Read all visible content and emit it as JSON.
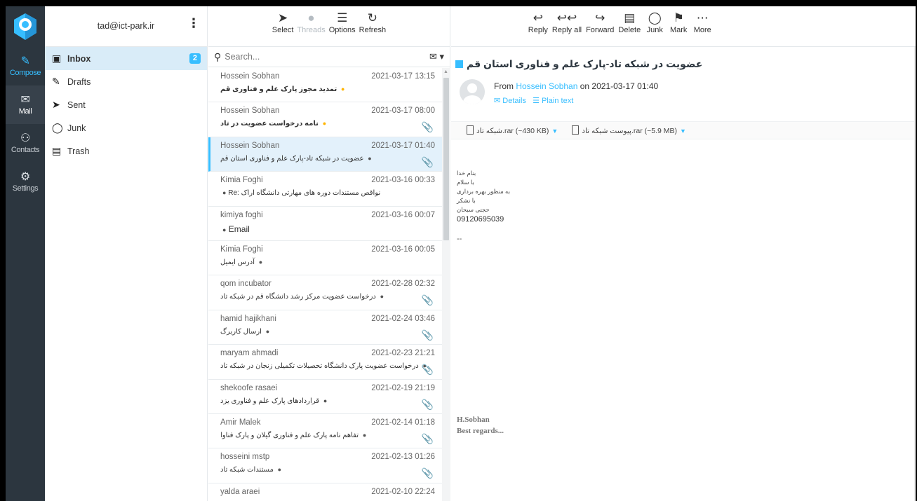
{
  "nav": {
    "items": [
      {
        "label": "Compose",
        "icon": "compose-icon"
      },
      {
        "label": "Mail",
        "icon": "envelope-icon"
      },
      {
        "label": "Contacts",
        "icon": "contacts-icon"
      },
      {
        "label": "Settings",
        "icon": "gear-icon"
      }
    ],
    "active": "Mail"
  },
  "account": {
    "email": "tad@ict-park.ir"
  },
  "folders": [
    {
      "label": "Inbox",
      "icon": "inbox-icon",
      "count": "2",
      "selected": true
    },
    {
      "label": "Drafts",
      "icon": "pencil-icon"
    },
    {
      "label": "Sent",
      "icon": "paper-plane-icon"
    },
    {
      "label": "Junk",
      "icon": "fire-icon"
    },
    {
      "label": "Trash",
      "icon": "trash-icon"
    }
  ],
  "list_toolbar": {
    "select": "Select",
    "threads": "Threads",
    "options": "Options",
    "refresh": "Refresh"
  },
  "search": {
    "placeholder": "Search..."
  },
  "messages": [
    {
      "from": "Hossein Sobhan",
      "date": "2021-03-17 13:15",
      "subject": "تمدید مجوز پارک علم و فناوری قم",
      "unread": true,
      "flag": true,
      "attachment": false
    },
    {
      "from": "Hossein Sobhan",
      "date": "2021-03-17 08:00",
      "subject": "نامه درخواست عضویت در تاد",
      "unread": true,
      "flag": true,
      "attachment": true
    },
    {
      "from": "Hossein Sobhan",
      "date": "2021-03-17 01:40",
      "subject": "عضویت در شبکه تاد-پارک علم و فناوری استان قم",
      "selected": true,
      "attachment": true
    },
    {
      "from": "Kimia Foghi",
      "date": "2021-03-16 00:33",
      "subject": "Re: نواقص مستندات دوره های مهارتی دانشگاه اراک",
      "attachment": false
    },
    {
      "from": "kimiya foghi",
      "date": "2021-03-16 00:07",
      "subject": "Email",
      "attachment": false
    },
    {
      "from": "Kimia Foghi",
      "date": "2021-03-16 00:05",
      "subject": "آدرس ایمیل",
      "attachment": false
    },
    {
      "from": "qom incubator",
      "date": "2021-02-28 02:32",
      "subject": "درخواست عضویت مرکز رشد دانشگاه قم در شبکه تاد",
      "attachment": true
    },
    {
      "from": "hamid hajikhani",
      "date": "2021-02-24 03:46",
      "subject": "ارسال کاربرگ",
      "attachment": true
    },
    {
      "from": "maryam ahmadi",
      "date": "2021-02-23 21:21",
      "subject": "درخواست عضویت پارک دانشگاه تحصیلات تکمیلی زنجان در شبکه تاد",
      "attachment": true
    },
    {
      "from": "shekoofe rasaei",
      "date": "2021-02-19 21:19",
      "subject": "قراردادهای پارک علم و فناوری یزد",
      "attachment": true
    },
    {
      "from": "Amir Malek",
      "date": "2021-02-14 01:18",
      "subject": "تفاهم نامه پارک علم و فناوری گیلان و پارک فناوا",
      "attachment": true
    },
    {
      "from": "hosseini mstp",
      "date": "2021-02-13 01:26",
      "subject": "مستندات شبکه تاد",
      "attachment": true
    },
    {
      "from": "yalda araei",
      "date": "2021-02-10 22:24",
      "subject": "",
      "attachment": true
    }
  ],
  "preview_toolbar": {
    "reply": "Reply",
    "reply_all": "Reply all",
    "forward": "Forward",
    "delete": "Delete",
    "junk": "Junk",
    "mark": "Mark",
    "more": "More"
  },
  "message": {
    "subject": "عضویت در شبکه تاد-پارک علم و فناوری استان قم",
    "from_prefix": "From",
    "from_name": "Hossein Sobhan",
    "date_text": "on 2021-03-17 01:40",
    "details": "Details",
    "plain_text": "Plain text",
    "attachments": [
      {
        "name": "شبکه تاد.rar",
        "size": "(~430 KB)"
      },
      {
        "name": "پیوست شبکه تاد.rar",
        "size": "(~5.9 MB)"
      }
    ],
    "body_lines": [
      "بنام خدا",
      "با سلام",
      "به منظور بهره برداری",
      "با تشکر",
      "حجتی سبحان"
    ],
    "phone": "09120695039",
    "dash": "--",
    "signature_name": "H.Sobhan",
    "signature_regards": "Best regards..."
  },
  "colors": {
    "accent": "#37beff",
    "nav_bg": "#2c363f",
    "selected_row": "#e3f1fb",
    "flag": "#ffb400"
  }
}
